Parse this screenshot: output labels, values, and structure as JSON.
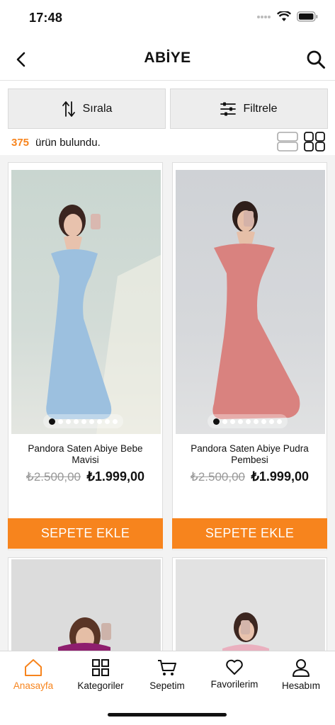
{
  "status": {
    "time": "17:48"
  },
  "nav": {
    "title": "ABİYE",
    "back_icon": "chevron-left-icon",
    "search_icon": "search-icon"
  },
  "controls": {
    "sort_label": "Sırala",
    "filter_label": "Filtrele"
  },
  "results": {
    "count": "375",
    "text": "ürün bulundu."
  },
  "products": [
    {
      "name": "Pandora Saten Abiye Bebe Mavisi",
      "old_price": "₺2.500,00",
      "price": "₺1.999,00",
      "button": "SEPETE EKLE",
      "dress_color": "#9cc0df",
      "images": 9
    },
    {
      "name": "Pandora Saten Abiye Pudra Pembesi",
      "old_price": "₺2.500,00",
      "price": "₺1.999,00",
      "button": "SEPETE EKLE",
      "dress_color": "#d9827f",
      "images": 9
    },
    {
      "dress_color": "#8e1e6e"
    },
    {
      "dress_color": "#eab0bf"
    }
  ],
  "tabs": [
    {
      "label": "Anasayfa",
      "icon": "home-icon",
      "active": true
    },
    {
      "label": "Kategoriler",
      "icon": "grid-icon",
      "active": false
    },
    {
      "label": "Sepetim",
      "icon": "cart-icon",
      "active": false
    },
    {
      "label": "Favorilerim",
      "icon": "heart-icon",
      "active": false
    },
    {
      "label": "Hesabım",
      "icon": "user-icon",
      "active": false
    }
  ],
  "colors": {
    "accent": "#f7841d",
    "control_bg": "#ededed"
  }
}
